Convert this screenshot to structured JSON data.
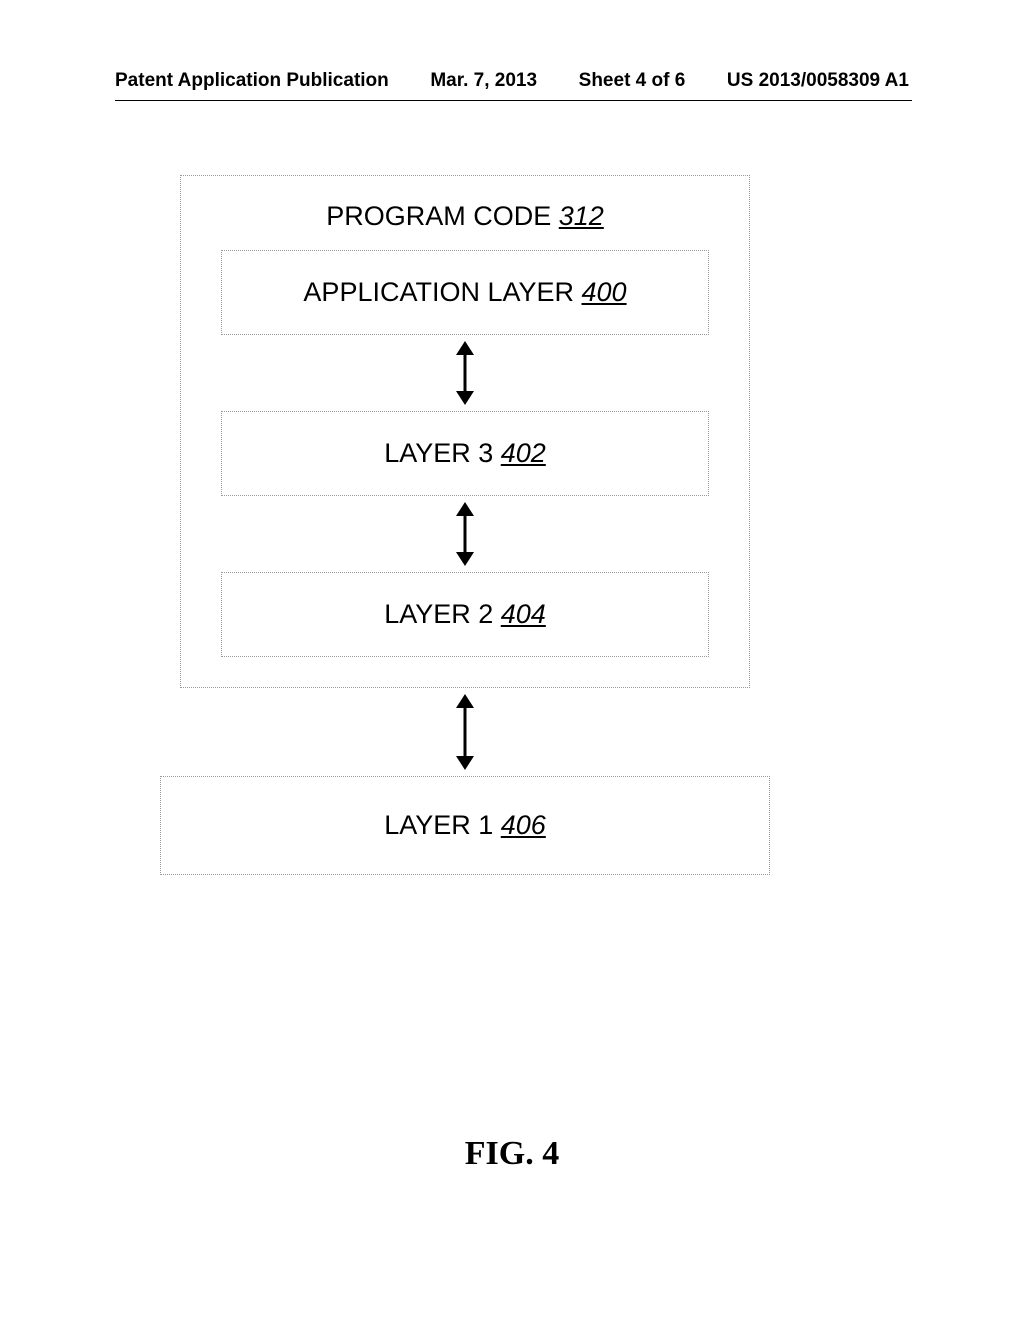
{
  "header": {
    "publication": "Patent Application Publication",
    "date": "Mar. 7, 2013",
    "sheet": "Sheet 4 of 6",
    "pubnum": "US 2013/0058309 A1"
  },
  "diagram": {
    "title_label": "PROGRAM CODE ",
    "title_ref": "312",
    "app_layer_label": "APPLICATION LAYER ",
    "app_layer_ref": "400",
    "layer3_label": "LAYER 3  ",
    "layer3_ref": "402",
    "layer2_label": "LAYER 2 ",
    "layer2_ref": "404",
    "layer1_label": "LAYER 1 ",
    "layer1_ref": "406"
  },
  "figure_label": "FIG. 4"
}
